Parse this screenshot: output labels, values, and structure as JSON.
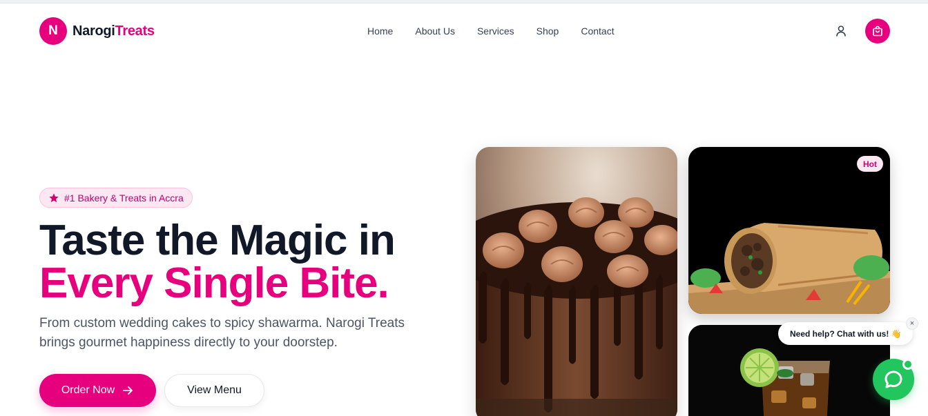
{
  "brand": {
    "initial": "N",
    "name_part1": "Narogi",
    "name_part2": "Treats"
  },
  "nav": {
    "items": [
      "Home",
      "About Us",
      "Services",
      "Shop",
      "Contact"
    ]
  },
  "hero": {
    "badge": "#1 Bakery & Treats in Accra",
    "title_line1": "Taste the Magic in",
    "title_line2": "Every Single Bite.",
    "subtitle": "From custom wedding cakes to spicy shawarma. Narogi Treats brings gourmet happiness directly to your doorstep.",
    "order_button": "Order Now",
    "menu_button": "View Menu"
  },
  "cards": {
    "hot_badge": "Hot"
  },
  "chat": {
    "prompt": "Need help? Chat with us! 👋",
    "close": "×"
  },
  "colors": {
    "accent": "#e6007e",
    "dark": "#111827",
    "chat_green": "#22c55e"
  },
  "icons": [
    "user-icon",
    "shopping-bag-icon",
    "star-icon",
    "arrow-right-icon",
    "chat-icon",
    "close-icon"
  ]
}
